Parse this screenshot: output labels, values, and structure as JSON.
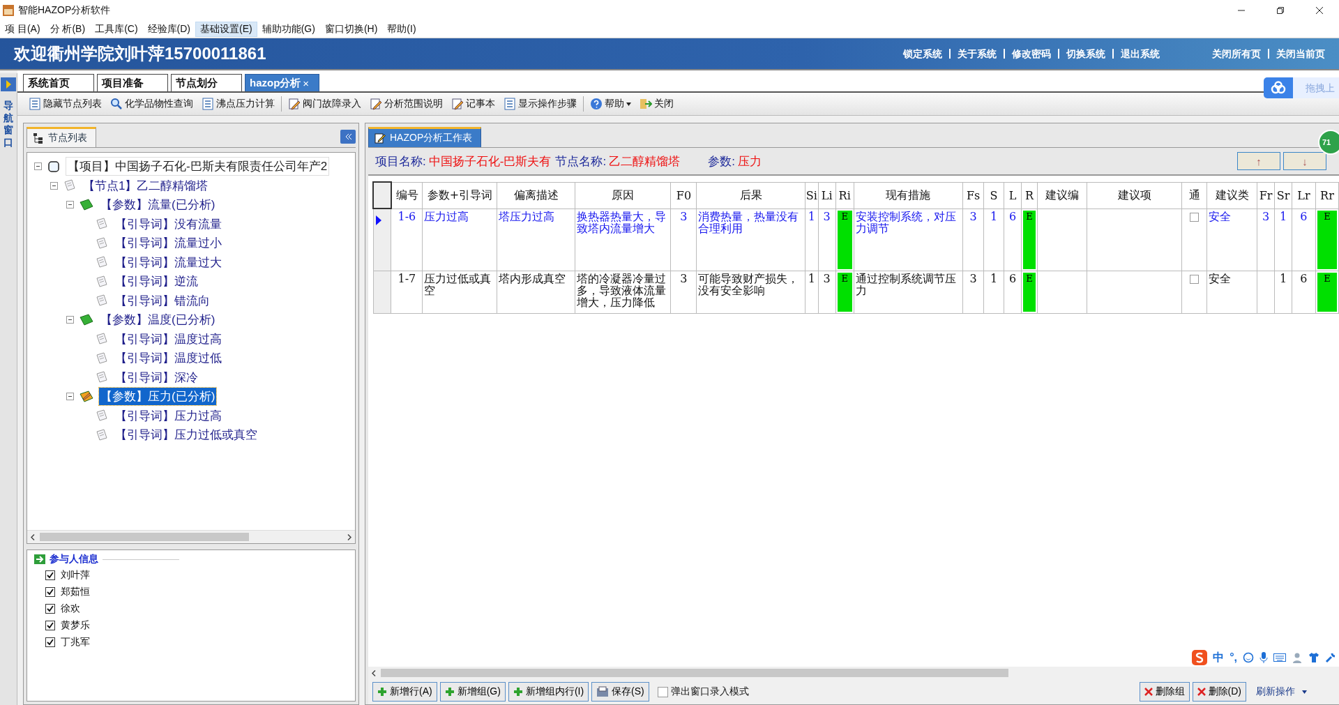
{
  "window": {
    "title": "智能HAZOP分析软件"
  },
  "menu": [
    {
      "label": "项 目(A)",
      "selected": false
    },
    {
      "label": "分 析(B)",
      "selected": false
    },
    {
      "label": "工具库(C)",
      "selected": false
    },
    {
      "label": "经验库(D)",
      "selected": false
    },
    {
      "label": "基础设置(E)",
      "selected": true
    },
    {
      "label": "辅助功能(G)",
      "selected": false
    },
    {
      "label": "窗口切换(H)",
      "selected": false
    },
    {
      "label": "帮助(I)",
      "selected": false
    }
  ],
  "banner": {
    "welcome": "欢迎衢州学院刘叶萍15700011861",
    "links": [
      "锁定系统",
      "关于系统",
      "修改密码",
      "切换系统",
      "退出系统"
    ],
    "page_links": [
      "关闭所有页",
      "关闭当前页"
    ]
  },
  "nav": {
    "label": "导航窗口"
  },
  "tabs": [
    {
      "label": "系统首页",
      "selected": false
    },
    {
      "label": "项目准备",
      "selected": false
    },
    {
      "label": "节点划分",
      "selected": false
    },
    {
      "label": "hazop分析",
      "selected": true,
      "close": "×"
    }
  ],
  "upload_widget": {
    "label": "拖拽上"
  },
  "toolbar": [
    [
      {
        "label": "隐藏节点列表"
      },
      {
        "label": "化学品物性查询"
      },
      {
        "label": "沸点压力计算"
      }
    ],
    [
      {
        "label": "阀门故障录入"
      },
      {
        "label": "分析范围说明"
      },
      {
        "label": "记事本"
      },
      {
        "label": "显示操作步骤"
      }
    ],
    [
      {
        "label": "帮助",
        "dropdown": true
      },
      {
        "label": "关闭"
      }
    ]
  ],
  "node_panel": {
    "title": "节点列表",
    "tree": [
      {
        "kind": "project",
        "label": "【项目】中国扬子石化-巴斯夫有限责任公司年产2",
        "selected": false,
        "expanded": true,
        "children": [
          {
            "kind": "node",
            "label": "【节点1】乙二醇精馏塔",
            "selected": false,
            "expanded": true,
            "children": [
              {
                "kind": "param",
                "label": "【参数】流量(已分析)",
                "selected": false,
                "expanded": true,
                "children": [
                  {
                    "kind": "guideword",
                    "label": "【引导词】没有流量",
                    "selected": false
                  },
                  {
                    "kind": "guideword",
                    "label": "【引导词】流量过小",
                    "selected": false
                  },
                  {
                    "kind": "guideword",
                    "label": "【引导词】流量过大",
                    "selected": false
                  },
                  {
                    "kind": "guideword",
                    "label": "【引导词】逆流",
                    "selected": false
                  },
                  {
                    "kind": "guideword",
                    "label": "【引导词】错流向",
                    "selected": false
                  }
                ]
              },
              {
                "kind": "param",
                "label": "【参数】温度(已分析)",
                "selected": false,
                "expanded": true,
                "children": [
                  {
                    "kind": "guideword",
                    "label": "【引导词】温度过高",
                    "selected": false
                  },
                  {
                    "kind": "guideword",
                    "label": "【引导词】温度过低",
                    "selected": false
                  },
                  {
                    "kind": "guideword",
                    "label": "【引导词】深冷",
                    "selected": false
                  }
                ]
              },
              {
                "kind": "param",
                "label": "【参数】压力(已分析)",
                "selected": true,
                "expanded": true,
                "children": [
                  {
                    "kind": "guideword",
                    "label": "【引导词】压力过高",
                    "selected": false
                  },
                  {
                    "kind": "guideword",
                    "label": "【引导词】压力过低或真空",
                    "selected": false
                  }
                ]
              }
            ]
          }
        ]
      }
    ]
  },
  "participants": {
    "title": "参与人信息",
    "people": [
      {
        "name": "刘叶萍",
        "checked": true
      },
      {
        "name": "郑茹恒",
        "checked": true
      },
      {
        "name": "徐欢",
        "checked": true
      },
      {
        "name": "黄梦乐",
        "checked": true
      },
      {
        "name": "丁兆军",
        "checked": true
      }
    ]
  },
  "worksheet": {
    "title": "HAZOP分析工作表",
    "info": [
      {
        "label": "项目名称:",
        "value": "中国扬子石化-巴斯夫有"
      },
      {
        "label": "节点名称:",
        "value": "乙二醇精馏塔"
      },
      {
        "label": "参数:",
        "value": "压力"
      }
    ],
    "nav_buttons": [
      "↑",
      "↓"
    ],
    "badge": "71",
    "columns": [
      "编号",
      "参数+引导词",
      "偏离描述",
      "原因",
      "F0",
      "后果",
      "Si",
      "Li",
      "Ri",
      "现有措施",
      "Fs",
      "S",
      "L",
      "R",
      "建议编",
      "建议项",
      "通",
      "建议类",
      "Fr",
      "Sr",
      "Lr",
      "Rr"
    ],
    "rows": [
      {
        "selected": true,
        "cells": [
          "1-6",
          "压力过高",
          "塔压力过高",
          "换热器热量大，导致塔内流量增大",
          "3",
          "消费热量，热量没有合理利用",
          "1",
          "3",
          {
            "kind": "risk",
            "text": "E"
          },
          "安装控制系统，对压力调节",
          "3",
          "1",
          "6",
          {
            "kind": "risk",
            "text": "E"
          },
          null,
          null,
          {
            "kind": "checkbox",
            "checked": false
          },
          "安全",
          "3",
          "1",
          "6",
          {
            "kind": "risk",
            "text": "E"
          }
        ]
      },
      {
        "selected": false,
        "cells": [
          "1-7",
          "压力过低或真空",
          "塔内形成真空",
          "塔的冷凝器冷量过多，导致液体流量增大，压力降低",
          "3",
          "可能导致财产损失，没有安全影响",
          "1",
          "3",
          {
            "kind": "risk",
            "text": "E"
          },
          "通过控制系统调节压力",
          "3",
          "1",
          "6",
          {
            "kind": "risk",
            "text": "E"
          },
          null,
          null,
          {
            "kind": "checkbox",
            "checked": false
          },
          "安全",
          null,
          "1",
          "6",
          {
            "kind": "risk",
            "text": "E"
          }
        ]
      }
    ],
    "actions": [
      {
        "label": "新增行(A)",
        "kind": "add"
      },
      {
        "label": "新增组(G)",
        "kind": "add"
      },
      {
        "label": "新增组内行(I)",
        "kind": "add"
      },
      {
        "label": "保存(S)",
        "kind": "save"
      }
    ],
    "popup_mode": {
      "label": "弹出窗口录入模式",
      "checked": false
    },
    "delete_actions": [
      "删除组",
      "删除(D)"
    ],
    "refresh": {
      "label": "刷新操作"
    }
  },
  "ime_bar": {
    "mode": "中",
    "punct": "°,"
  }
}
